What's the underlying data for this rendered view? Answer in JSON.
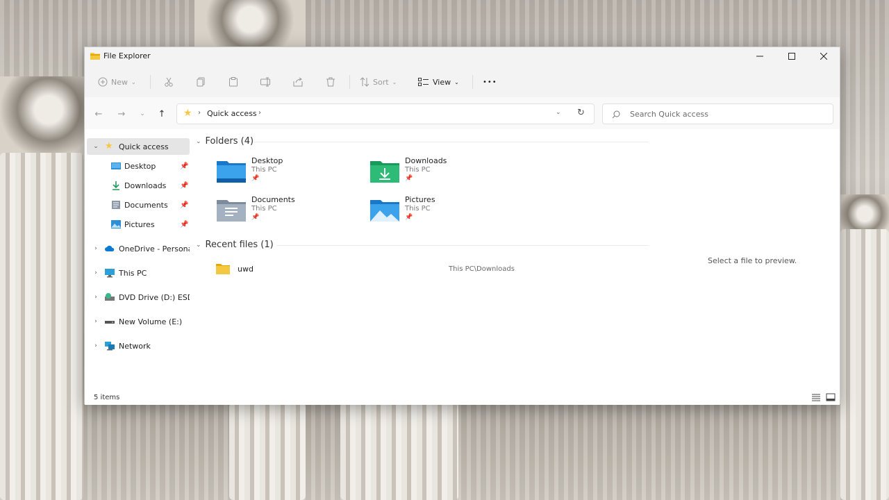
{
  "window": {
    "title": "File Explorer"
  },
  "toolbar": {
    "new_label": "New",
    "sort_label": "Sort",
    "view_label": "View",
    "more_label": "•••"
  },
  "address": {
    "crumb": "Quick access",
    "search_placeholder": "Search Quick access"
  },
  "sidebar": {
    "quick_access": "Quick access",
    "pinned": [
      "Desktop",
      "Downloads",
      "Documents",
      "Pictures"
    ],
    "onedrive": "OneDrive - Personal",
    "this_pc": "This PC",
    "dvd": "DVD Drive (D:) ESD-I",
    "volume": "New Volume (E:)",
    "network": "Network"
  },
  "folders": {
    "header": "Folders (4)",
    "items": [
      {
        "name": "Desktop",
        "location": "This PC"
      },
      {
        "name": "Downloads",
        "location": "This PC"
      },
      {
        "name": "Documents",
        "location": "This PC"
      },
      {
        "name": "Pictures",
        "location": "This PC"
      }
    ]
  },
  "recent": {
    "header": "Recent files (1)",
    "items": [
      {
        "name": "uwd",
        "path": "This PC\\Downloads"
      }
    ]
  },
  "preview": {
    "message": "Select a file to preview."
  },
  "status": {
    "count": "5 items"
  },
  "colors": {
    "folder_yellow": "#f5c842",
    "accent_blue": "#0a7ad4",
    "selection": "#e5e5e5"
  }
}
